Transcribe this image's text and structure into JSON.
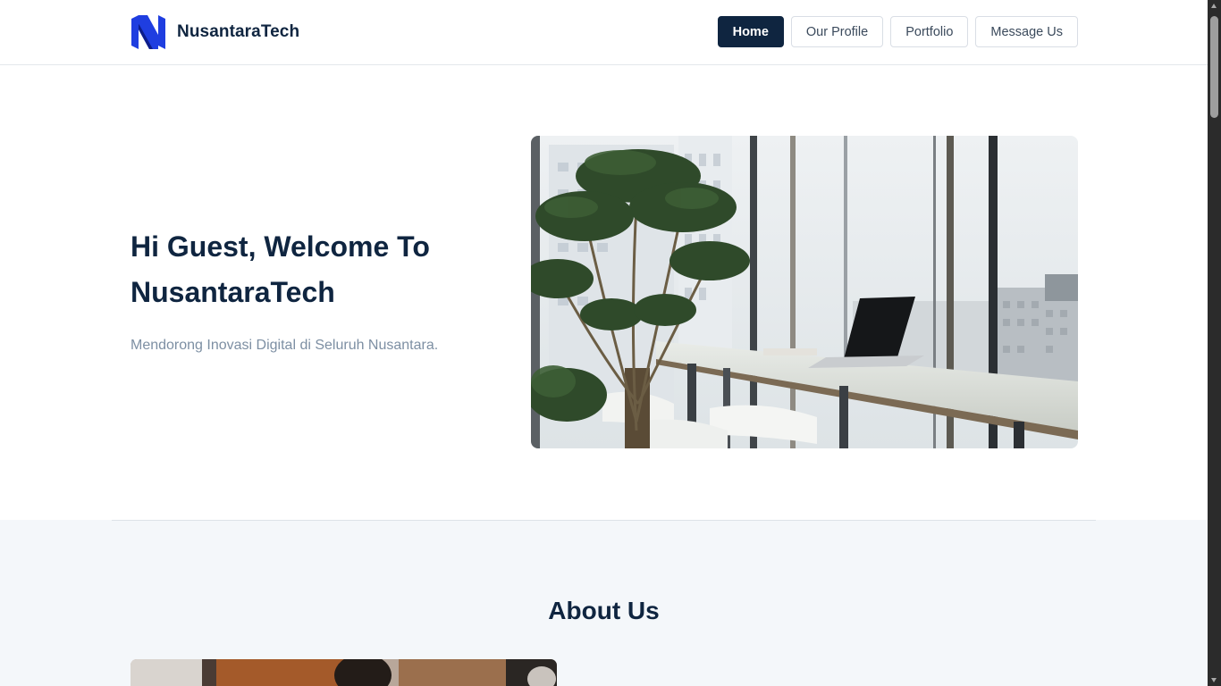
{
  "header": {
    "brand_name": "NusantaraTech",
    "logo_icon": "n-letter-logo-icon",
    "nav": [
      {
        "label": "Home",
        "active": true
      },
      {
        "label": "Our Profile",
        "active": false
      },
      {
        "label": "Portfolio",
        "active": false
      },
      {
        "label": "Message Us",
        "active": false
      }
    ]
  },
  "hero": {
    "title": "Hi Guest, Welcome To NusantaraTech",
    "subtitle": "Mendorong Inovasi Digital di Seluruh Nusantara."
  },
  "about": {
    "title": "About Us"
  },
  "colors": {
    "primary": "#0f2540",
    "accent_logo": "#1f3ee0",
    "muted_text": "#7d8fa3",
    "section_bg": "#f4f7fa"
  }
}
